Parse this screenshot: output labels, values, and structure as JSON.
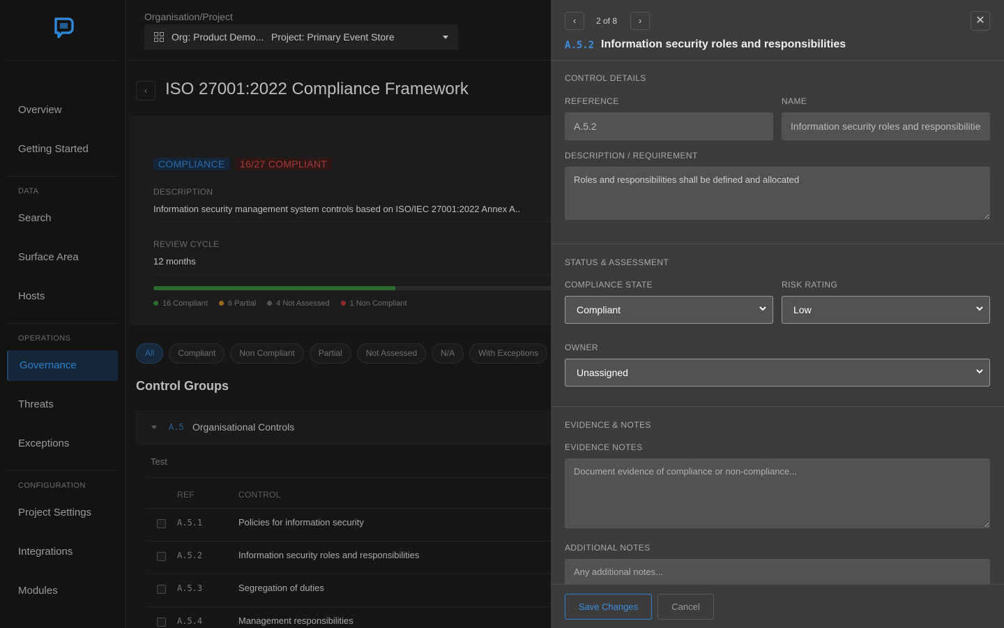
{
  "sidebar": {
    "items_top": [
      {
        "label": "Overview"
      },
      {
        "label": "Getting Started"
      }
    ],
    "sections": [
      {
        "title": "DATA",
        "items": [
          {
            "label": "Search"
          },
          {
            "label": "Surface Area"
          },
          {
            "label": "Hosts"
          }
        ]
      },
      {
        "title": "OPERATIONS",
        "items": [
          {
            "label": "Governance"
          },
          {
            "label": "Threats"
          },
          {
            "label": "Exceptions"
          }
        ]
      },
      {
        "title": "CONFIGURATION",
        "items": [
          {
            "label": "Project Settings"
          },
          {
            "label": "Integrations"
          },
          {
            "label": "Modules"
          }
        ]
      }
    ]
  },
  "header": {
    "org_project_label": "Organisation/Project",
    "org_text": "Org: Product Demo...",
    "project_text": "Project: Primary Event Store"
  },
  "framework": {
    "title": "ISO 27001:2022 Compliance Framework",
    "badge_type": "COMPLIANCE",
    "badge_count": "16/27 COMPLIANT",
    "description_label": "DESCRIPTION",
    "description": "Information security management system controls based on ISO/IEC 27001:2022 Annex A..",
    "review_cycle_label": "REVIEW CYCLE",
    "review_cycle": "12 months",
    "compliant_fraction": 0.593,
    "legend": [
      {
        "text": "16 Compliant",
        "color": "#2a6b2e"
      },
      {
        "text": "6 Partial",
        "color": "#9a6a1c"
      },
      {
        "text": "4 Not Assessed",
        "color": "#555555"
      },
      {
        "text": "1 Non Compliant",
        "color": "#8c2a2a"
      }
    ]
  },
  "filters": [
    "All",
    "Compliant",
    "Non Compliant",
    "Partial",
    "Not Assessed",
    "N/A",
    "With Exceptions"
  ],
  "control_groups": {
    "title": "Control Groups",
    "group_ref": "A.5",
    "group_name": "Organisational Controls",
    "test_label": "Test",
    "col_ref": "REF",
    "col_control": "CONTROL",
    "rows": [
      {
        "ref": "A.5.1",
        "control": "Policies for information security"
      },
      {
        "ref": "A.5.2",
        "control": "Information security roles and responsibilities"
      },
      {
        "ref": "A.5.3",
        "control": "Segregation of duties"
      },
      {
        "ref": "A.5.4",
        "control": "Management responsibilities"
      }
    ]
  },
  "drawer": {
    "counter": "2 of 8",
    "ref": "A.5.2",
    "title": "Information security roles and responsibilities",
    "control_details": {
      "section_title": "CONTROL DETAILS",
      "reference_label": "REFERENCE",
      "reference_value": "A.5.2",
      "name_label": "NAME",
      "name_value": "Information security roles and responsibilities",
      "description_label": "DESCRIPTION / REQUIREMENT",
      "description_value": "Roles and responsibilities shall be defined and allocated"
    },
    "status": {
      "section_title": "STATUS & ASSESSMENT",
      "compliance_label": "COMPLIANCE STATE",
      "compliance_value": "Compliant",
      "risk_label": "RISK RATING",
      "risk_value": "Low",
      "owner_label": "OWNER",
      "owner_value": "Unassigned"
    },
    "evidence": {
      "section_title": "EVIDENCE & NOTES",
      "evidence_label": "EVIDENCE NOTES",
      "evidence_placeholder": "Document evidence of compliance or non-compliance...",
      "additional_label": "ADDITIONAL NOTES",
      "additional_placeholder": "Any additional notes..."
    },
    "save_label": "Save Changes",
    "cancel_label": "Cancel"
  }
}
